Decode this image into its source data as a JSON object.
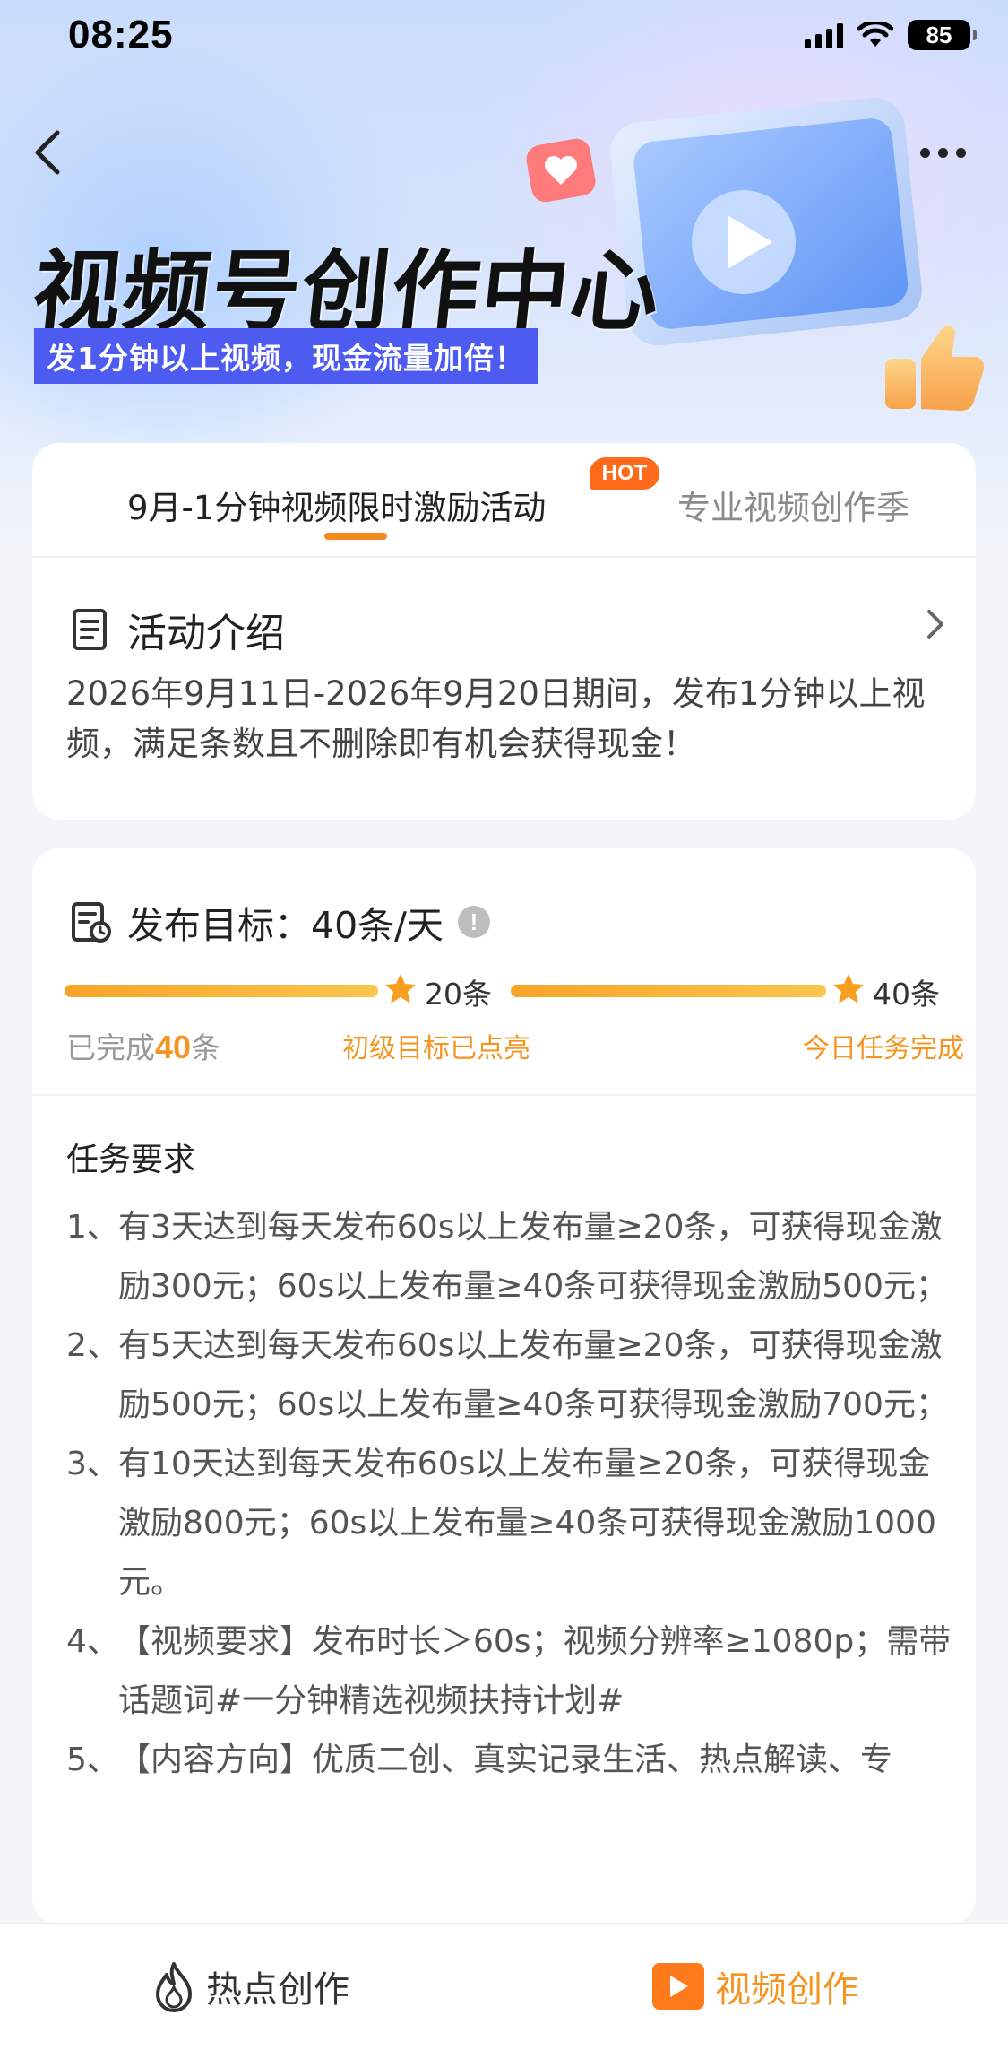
{
  "status_bar": {
    "time": "08:25",
    "battery": "85"
  },
  "hero": {
    "title": "视频号创作中心",
    "banner": "发1分钟以上视频，现金流量加倍！"
  },
  "tabs": {
    "active_label": "9月-1分钟视频限时激励活动",
    "hot_badge": "HOT",
    "other_label": "专业视频创作季"
  },
  "intro": {
    "title": "活动介绍",
    "text": "2026年9月11日-2026年9月20日期间，发布1分钟以上视频，满足条数且不删除即有机会获得现金！"
  },
  "goal": {
    "title": "发布目标：40条/天",
    "completed_prefix": "已完成",
    "completed_count": "40",
    "completed_suffix": "条",
    "progress_fraction": 1.0,
    "milestone1": {
      "label": "20条",
      "status": "初级目标已点亮"
    },
    "milestone2": {
      "label": "40条",
      "status": "今日任务完成"
    }
  },
  "requirements": {
    "title": "任务要求",
    "items": [
      {
        "num": "1、",
        "text": "有3天达到每天发布60s以上发布量≥20条，可获得现金激励300元；60s以上发布量≥40条可获得现金激励500元；"
      },
      {
        "num": "2、",
        "text": "有5天达到每天发布60s以上发布量≥20条，可获得现金激励500元；60s以上发布量≥40条可获得现金激励700元；"
      },
      {
        "num": "3、",
        "text": "有10天达到每天发布60s以上发布量≥20条，可获得现金激励800元；60s以上发布量≥40条可获得现金激励1000元。"
      },
      {
        "num": "4、",
        "text": "【视频要求】发布时长＞60s；视频分辨率≥1080p；需带话题词#一分钟精选视频扶持计划#"
      },
      {
        "num": "5、",
        "text": "【内容方向】优质二创、真实记录生活、热点解读、专"
      }
    ]
  },
  "bottom_bar": {
    "left_label": "热点创作",
    "right_label": "视频创作"
  },
  "colors": {
    "accent": "#f5941f",
    "banner": "#4d5bf0",
    "hot": "#ff6a1a"
  }
}
